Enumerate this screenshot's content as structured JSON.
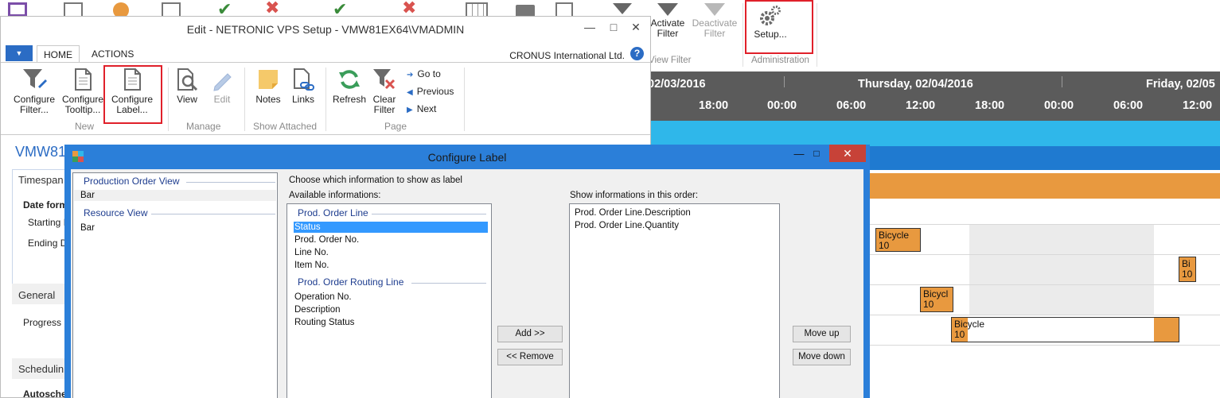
{
  "background_ribbon": {
    "activate_filter": "Activate\nFilter",
    "deactivate_filter": "Deactivate\nFilter",
    "setup": "Setup...",
    "view_filter_group": "View Filter",
    "administration_group": "Administration"
  },
  "gantt": {
    "dates": [
      "02/03/2016",
      "Thursday, 02/04/2016",
      "Friday, 02/05"
    ],
    "times": [
      "18:00",
      "00:00",
      "06:00",
      "12:00",
      "18:00",
      "00:00",
      "06:00",
      "12:00"
    ],
    "bars": [
      {
        "title": "Bicycle",
        "qty": "10"
      },
      {
        "title": "Bi",
        "qty": "10"
      },
      {
        "title": "Bicycl",
        "qty": "10"
      },
      {
        "title": "Bicycle",
        "qty": "10"
      }
    ],
    "colors": {
      "header": "#5b5b5b",
      "cyan_band": "#2fb7ea",
      "blue_band": "#1f7ad0",
      "orange_band": "#e8993f",
      "bar": "#e8993f"
    }
  },
  "edit_window": {
    "title": "Edit - NETRONIC VPS Setup - VMW81EX64\\VMADMIN",
    "tabs": [
      "HOME",
      "ACTIONS"
    ],
    "company": "CRONUS International Ltd.",
    "ribbon": {
      "configure_filter": "Configure\nFilter...",
      "configure_tooltip": "Configure\nTooltip...",
      "configure_label": "Configure\nLabel...",
      "view": "View",
      "edit": "Edit",
      "notes": "Notes",
      "links": "Links",
      "refresh": "Refresh",
      "clear_filter": "Clear\nFilter",
      "go_to": "Go to",
      "previous": "Previous",
      "next": "Next",
      "groups": {
        "new": "New",
        "manage": "Manage",
        "show_attached": "Show Attached",
        "page": "Page"
      }
    },
    "page_heading": "VMW81",
    "fasttabs": [
      "Timespan",
      "General",
      "Schedulin"
    ],
    "fields": [
      "Date form",
      "Starting D",
      "Ending D",
      "Progress C",
      "Autosche"
    ]
  },
  "dialog": {
    "title": "Configure Label",
    "views": [
      {
        "header": "Production Order View",
        "items": [
          "Bar"
        ]
      },
      {
        "header": "Resource View",
        "items": [
          "Bar"
        ]
      }
    ],
    "instruction": "Choose which information to show as label",
    "available_label": "Available informations:",
    "available_groups": [
      {
        "header": "Prod. Order Line",
        "items": [
          "Status",
          "Prod. Order No.",
          "Line No.",
          "Item No."
        ]
      },
      {
        "header": "Prod. Order Routing Line",
        "items": [
          "Operation No.",
          "Description",
          "Routing Status"
        ]
      }
    ],
    "selected_item": "Status",
    "order_label": "Show informations in this order:",
    "order_items": [
      "Prod. Order Line.Description",
      "Prod. Order Line.Quantity"
    ],
    "buttons": {
      "add": "Add >>",
      "remove": "<< Remove",
      "move_up": "Move up",
      "move_down": "Move down"
    }
  }
}
